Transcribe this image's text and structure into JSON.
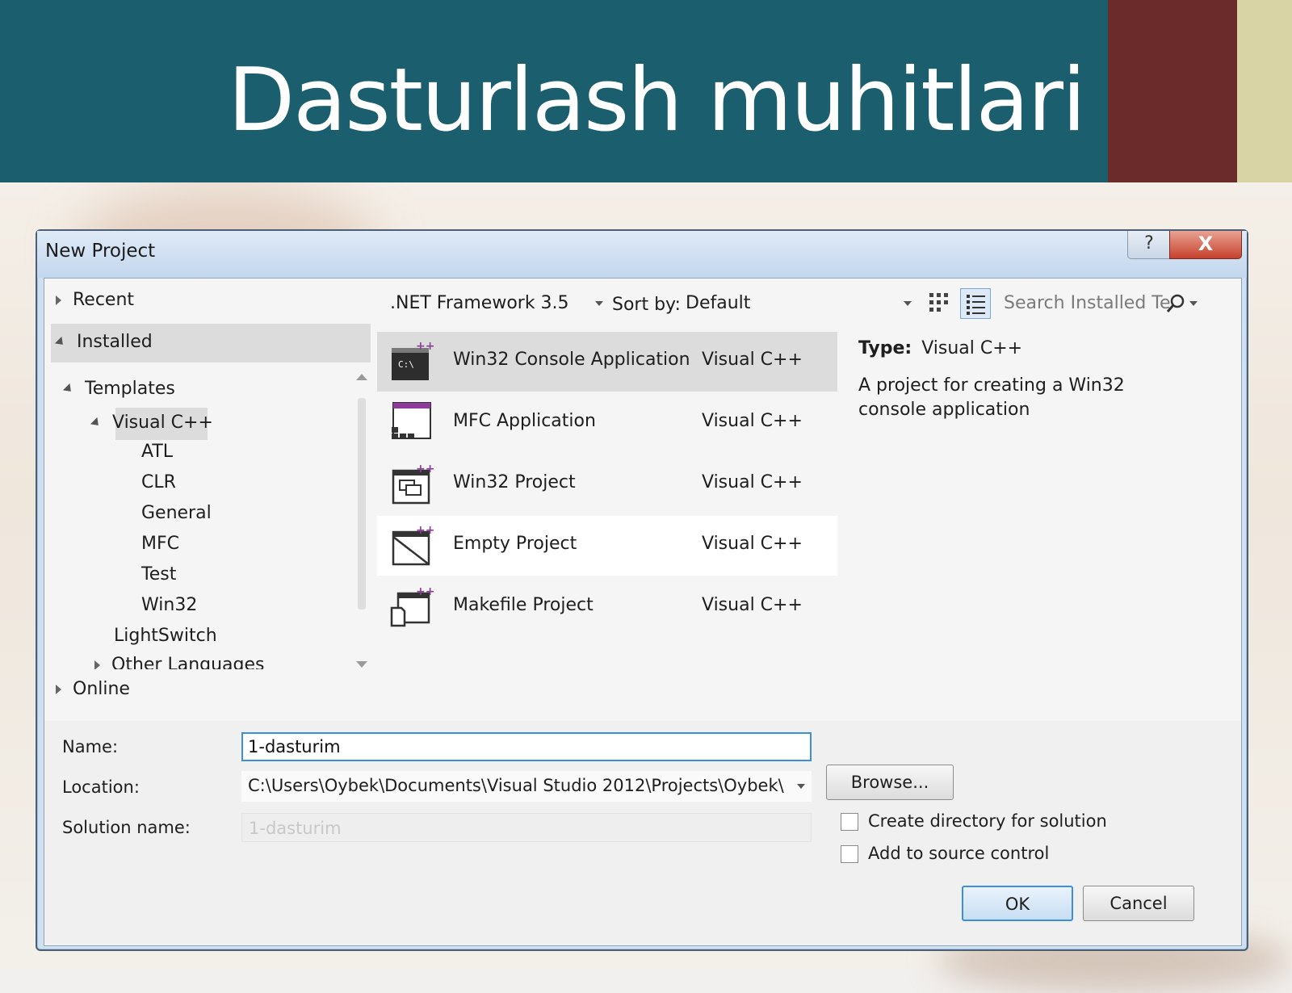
{
  "slide": {
    "title": "Dasturlash muhitlari"
  },
  "dialog": {
    "title": "New Project",
    "help_glyph": "?",
    "close_glyph": "X"
  },
  "tree": {
    "recent": "Recent",
    "installed": "Installed",
    "templates": "Templates",
    "visual_cpp": "Visual C++",
    "children": [
      "ATL",
      "CLR",
      "General",
      "MFC",
      "Test",
      "Win32"
    ],
    "lightswitch": "LightSwitch",
    "other_languages": "Other Languages",
    "online": "Online"
  },
  "toolbar": {
    "framework": ".NET Framework 3.5",
    "sort_label": "Sort by:",
    "sort_value": "Default",
    "search_placeholder": "Search Installed Te"
  },
  "templates": [
    {
      "name": "Win32 Console Application",
      "lang": "Visual C++",
      "icon": "console-app-icon",
      "state": "selected"
    },
    {
      "name": "MFC Application",
      "lang": "Visual C++",
      "icon": "mfc-app-icon",
      "state": "normal"
    },
    {
      "name": "Win32 Project",
      "lang": "Visual C++",
      "icon": "win32-project-icon",
      "state": "normal"
    },
    {
      "name": "Empty Project",
      "lang": "Visual C++",
      "icon": "empty-project-icon",
      "state": "hover"
    },
    {
      "name": "Makefile Project",
      "lang": "Visual C++",
      "icon": "makefile-project-icon",
      "state": "normal"
    }
  ],
  "description": {
    "type_label": "Type:",
    "type_value": "Visual C++",
    "text": "A project for creating a Win32 console application"
  },
  "form": {
    "name_label": "Name:",
    "name_value": "1-dasturim",
    "location_label": "Location:",
    "location_value": "C:\\Users\\Oybek\\Documents\\Visual Studio 2012\\Projects\\Oybek\\",
    "solution_label": "Solution name:",
    "solution_value": "1-dasturim",
    "browse": "Browse...",
    "create_dir": "Create directory for solution",
    "add_source": "Add to source control",
    "ok": "OK",
    "cancel": "Cancel"
  },
  "colors": {
    "header_bg": "#1b5e6e",
    "band_maroon": "#6b2b2b",
    "band_olive": "#d8d4a6",
    "selection": "#dcdcdc",
    "focus_blue": "#3c8fd9"
  }
}
